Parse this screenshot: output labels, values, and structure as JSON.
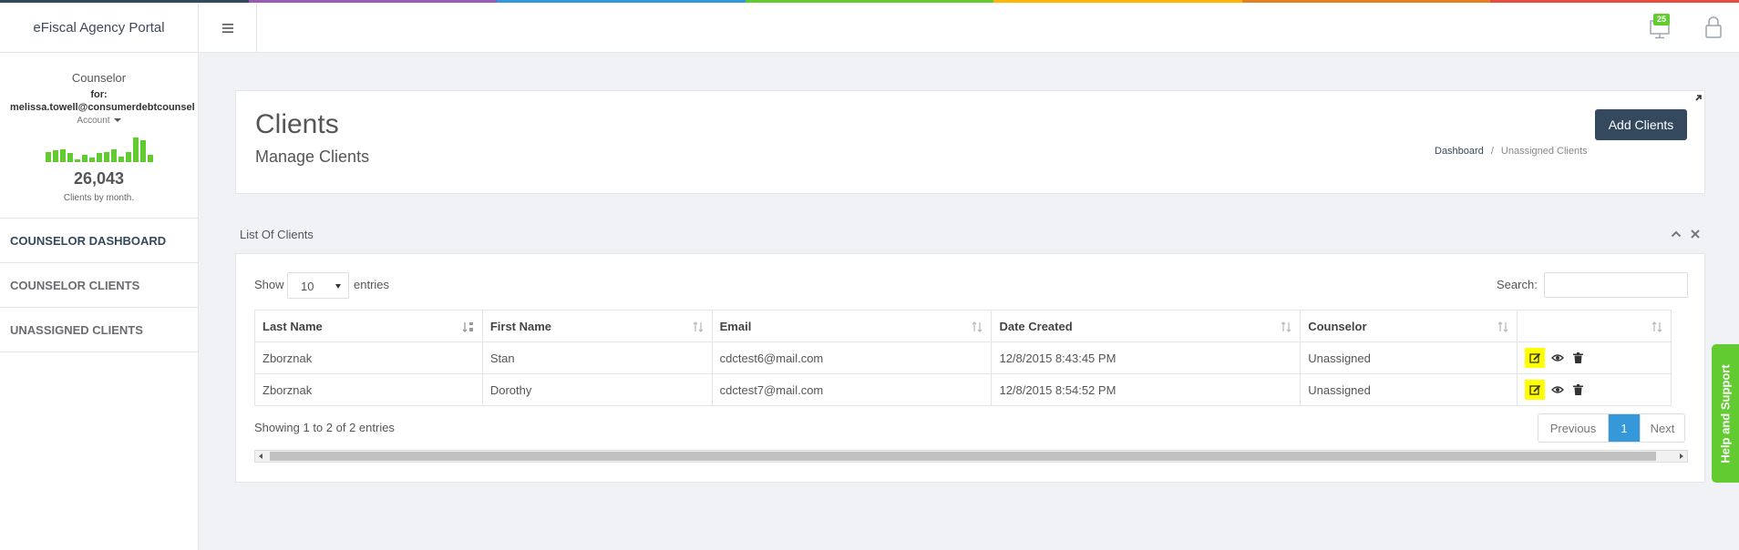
{
  "colors": {
    "rainbow": [
      "#34495e",
      "#9b59b6",
      "#3498db",
      "#62cb31",
      "#ffb606",
      "#e67e22",
      "#e74c3c"
    ],
    "accent": "#62cb31",
    "primary_button": "#34495e",
    "pager_active": "#3498db",
    "action_highlight": "#ffff00"
  },
  "header": {
    "brand": "eFiscal Agency Portal",
    "notification_count": "25"
  },
  "sidebar": {
    "role": "Counselor",
    "for_label": "for:",
    "email": "melissa.towell@consumerdebtcounsel",
    "account_label": "Account",
    "sparkline": [
      0.35,
      0.4,
      0.45,
      0.3,
      0.1,
      0.25,
      0.15,
      0.3,
      0.35,
      0.45,
      0.2,
      0.35,
      0.85,
      0.75,
      0.25
    ],
    "stat_value": "26,043",
    "stat_label": "Clients by month.",
    "nav": [
      {
        "label": "COUNSELOR DASHBOARD"
      },
      {
        "label": "COUNSELOR CLIENTS"
      },
      {
        "label": "UNASSIGNED CLIENTS"
      }
    ]
  },
  "page": {
    "title": "Clients",
    "subtitle": "Manage Clients",
    "add_button": "Add Clients",
    "breadcrumb": [
      "Dashboard",
      "/",
      "Unassigned Clients"
    ]
  },
  "list": {
    "title": "List Of Clients",
    "show_label": "Show",
    "page_size": "10",
    "entries_label": "entries",
    "search_label": "Search:",
    "columns": [
      "Last Name",
      "First Name",
      "Email",
      "Date Created",
      "Counselor",
      ""
    ],
    "rows": [
      [
        "Zborznak",
        "Stan",
        "cdctest6@mail.com",
        "12/8/2015 8:43:45 PM",
        "Unassigned"
      ],
      [
        "Zborznak",
        "Dorothy",
        "cdctest7@mail.com",
        "12/8/2015 8:54:52 PM",
        "Unassigned"
      ]
    ],
    "info": "Showing 1 to 2 of 2 entries",
    "pager": {
      "prev": "Previous",
      "current": "1",
      "next": "Next"
    }
  },
  "help_tab": "Help and Support"
}
